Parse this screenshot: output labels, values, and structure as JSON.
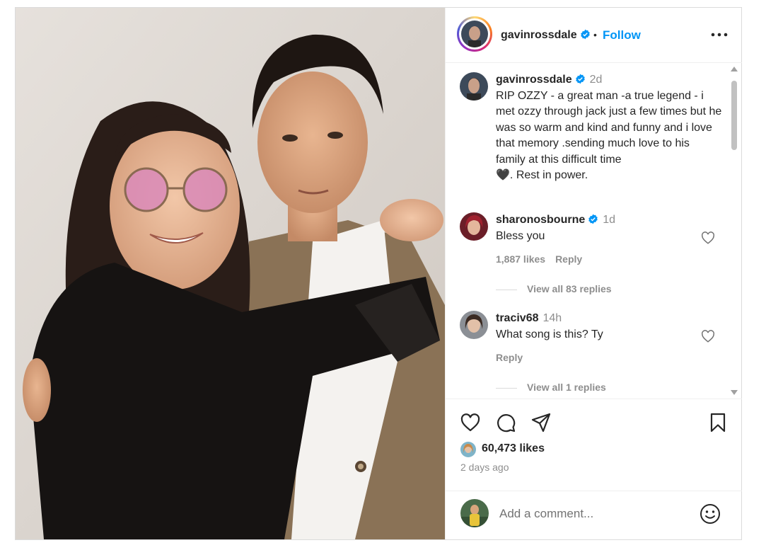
{
  "header": {
    "username": "gavinrossdale",
    "separator": "•",
    "follow_label": "Follow",
    "more_icon": "more-horizontal-icon",
    "verified_icon": "verified-badge-icon"
  },
  "caption": {
    "username": "gavinrossdale",
    "time": "2d",
    "text": "RIP OZZY - a great man -a true legend - i met ozzy through jack just a few times but he was so warm and kind and funny and i love that memory .sending much love to his family at this difficult time",
    "emoji": "🖤",
    "tail": ". Rest in power."
  },
  "comments": [
    {
      "username": "sharonosbourne",
      "verified": true,
      "time": "1d",
      "text": "Bless you",
      "likes": "1,887 likes",
      "reply_label": "Reply",
      "view_replies": "View all 83 replies"
    },
    {
      "username": "traciv68",
      "verified": false,
      "time": "14h",
      "text": "What song is this? Ty",
      "likes": "",
      "reply_label": "Reply",
      "view_replies": "View all 1 replies"
    }
  ],
  "actions": {
    "like_icon": "heart-icon",
    "comment_icon": "comment-bubble-icon",
    "share_icon": "paper-plane-icon",
    "save_icon": "bookmark-icon",
    "likes_count": "60,473 likes",
    "posted_ago": "2 days ago"
  },
  "add_comment": {
    "placeholder": "Add a comment...",
    "emoji_icon": "smiley-face-icon"
  },
  "colors": {
    "accent": "#0095f6",
    "text": "#262626",
    "muted": "#8e8e8e",
    "border": "#dbdbdb"
  }
}
